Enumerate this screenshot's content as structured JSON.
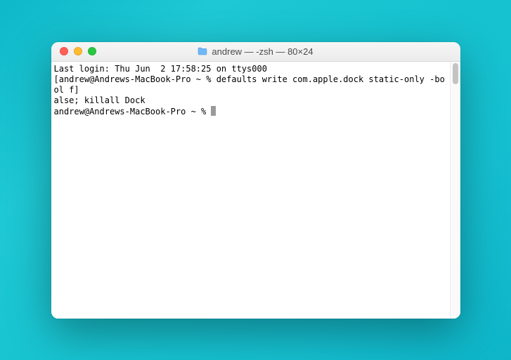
{
  "window": {
    "title": "andrew — -zsh — 80×24",
    "icon_name": "home-folder-icon"
  },
  "traffic_lights": {
    "close": "close",
    "minimize": "minimize",
    "maximize": "maximize"
  },
  "terminal": {
    "lines": [
      "Last login: Thu Jun  2 17:58:25 on ttys000",
      "[andrew@Andrews-MacBook-Pro ~ % defaults write com.apple.dock static-only -bool f]",
      "alse; killall Dock",
      "andrew@Andrews-MacBook-Pro ~ % "
    ]
  }
}
